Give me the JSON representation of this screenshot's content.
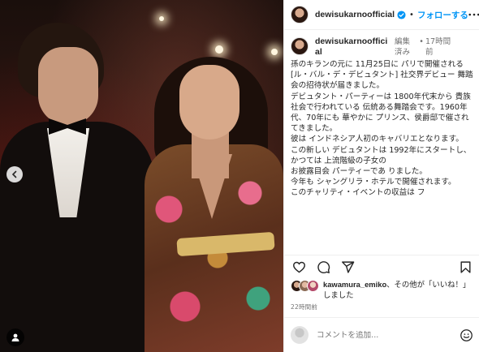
{
  "post": {
    "username": "dewisukarnoofficial",
    "follow_label": "フォローする",
    "separator": "•",
    "photo": {
      "carousel_prev_icon": "chevron-left-icon",
      "tag_icon": "user-tag-icon"
    }
  },
  "caption": {
    "username": "dewisukarnoofficial",
    "edited_label": "編集済み",
    "separator": "•",
    "time_label": "17時間前",
    "lines": [
      "孫のキランの元に 11月25日に パリで開催される [ル・バル・デ・デビュタント] 社交界デビュー 舞踏会の招待状が届きました。",
      "デビュタント・パーティーは 1800年代末から 貴族社会で行われている 伝統ある舞踏会です。1960年代、70年にも 華やかに プリンス、侯爵邸で催されてきました。",
      "彼は インドネシア人初のキャバリエとなります。",
      "この新しい デビュタントは 1992年にスタートし、かつては 上流階級の子女の",
      "お披露目会 パーティーであ りました。",
      "今年も シャングリラ・ホテルで開催されます。",
      "このチャリティ・イベントの収益は フ"
    ]
  },
  "actions": {
    "like_icon": "heart-icon",
    "comment_icon": "comment-icon",
    "share_icon": "paper-plane-icon",
    "save_icon": "bookmark-icon"
  },
  "likes": {
    "user": "kawamura_emiko",
    "text": "、その他が「いいね！」しました"
  },
  "timestamp": "22時間前",
  "comment": {
    "placeholder": "コメントを追加...",
    "emoji_icon": "smiley-icon"
  },
  "colors": {
    "accent": "#0095f6",
    "verified": "#0095f6",
    "muted": "#737373",
    "border": "#efefef"
  }
}
